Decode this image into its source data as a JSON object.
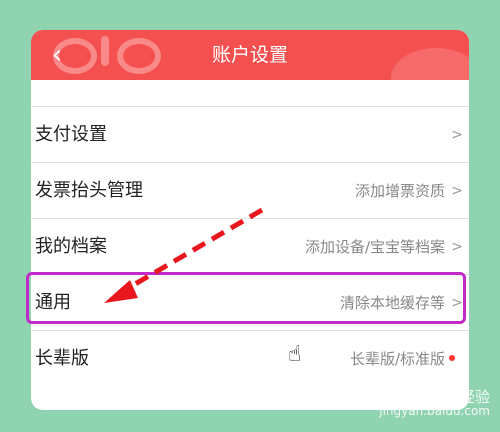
{
  "header": {
    "title": "账户设置"
  },
  "settings": {
    "items": [
      {
        "label": "支付设置",
        "value": ""
      },
      {
        "label": "发票抬头管理",
        "value": "添加增票资质"
      },
      {
        "label": "我的档案",
        "value": "添加设备/宝宝等档案"
      },
      {
        "label": "通用",
        "value": "清除本地缓存等"
      },
      {
        "label": "长辈版",
        "value": "长辈版/标准版"
      }
    ]
  },
  "colors": {
    "header_bg": "#f45050",
    "highlight": "#c02ac8",
    "arrow": "#e8171e",
    "badge_dot": "#ff3333"
  },
  "watermark": {
    "line1": "Bai 经验",
    "line2": "jingyan.baidu.com"
  }
}
